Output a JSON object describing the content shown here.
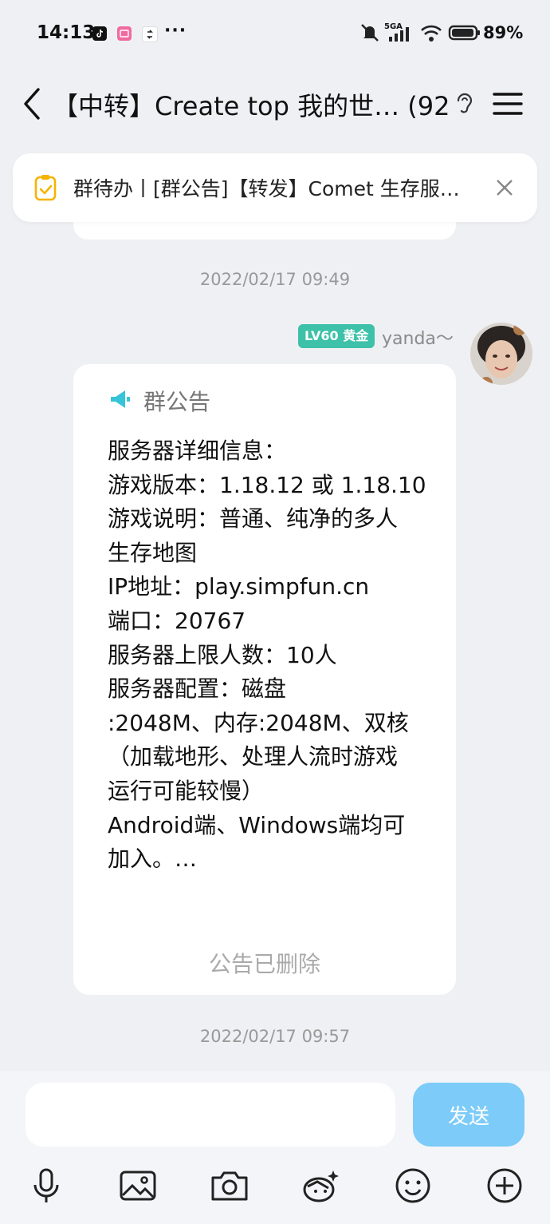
{
  "status_bar": {
    "time": "14:13",
    "more": "···",
    "network": "5GA",
    "battery": "89%"
  },
  "nav": {
    "title": "【中转】Create top 我的世… (92)"
  },
  "todo": {
    "text": "群待办丨[群公告]【转发】Comet 生存服…"
  },
  "timestamps": [
    "2022/02/17 09:49",
    "2022/02/17 09:57"
  ],
  "sender": {
    "level": "LV60 黄金",
    "name": "yanda～"
  },
  "notice": {
    "heading": "群公告",
    "lines": [
      "服务器详细信息：",
      "游戏版本：1.18.12 或 1.18.10",
      "游戏说明：普通、纯净的多人",
      "生存地图",
      "IP地址：play.simpfun.cn",
      "端口：20767",
      "服务器上限人数：10人",
      "服务器配置：磁盘",
      ":2048M、内存:2048M、双核",
      "（加载地形、处理人流时游戏",
      "运行可能较慢）",
      "Android端、Windows端均可",
      "加入。…"
    ],
    "deleted": "公告已删除"
  },
  "input": {
    "send_label": "发送"
  },
  "toolbar_icons": [
    "mic-icon",
    "image-icon",
    "camera-icon",
    "sticker-icon",
    "emoji-icon",
    "plus-icon"
  ]
}
